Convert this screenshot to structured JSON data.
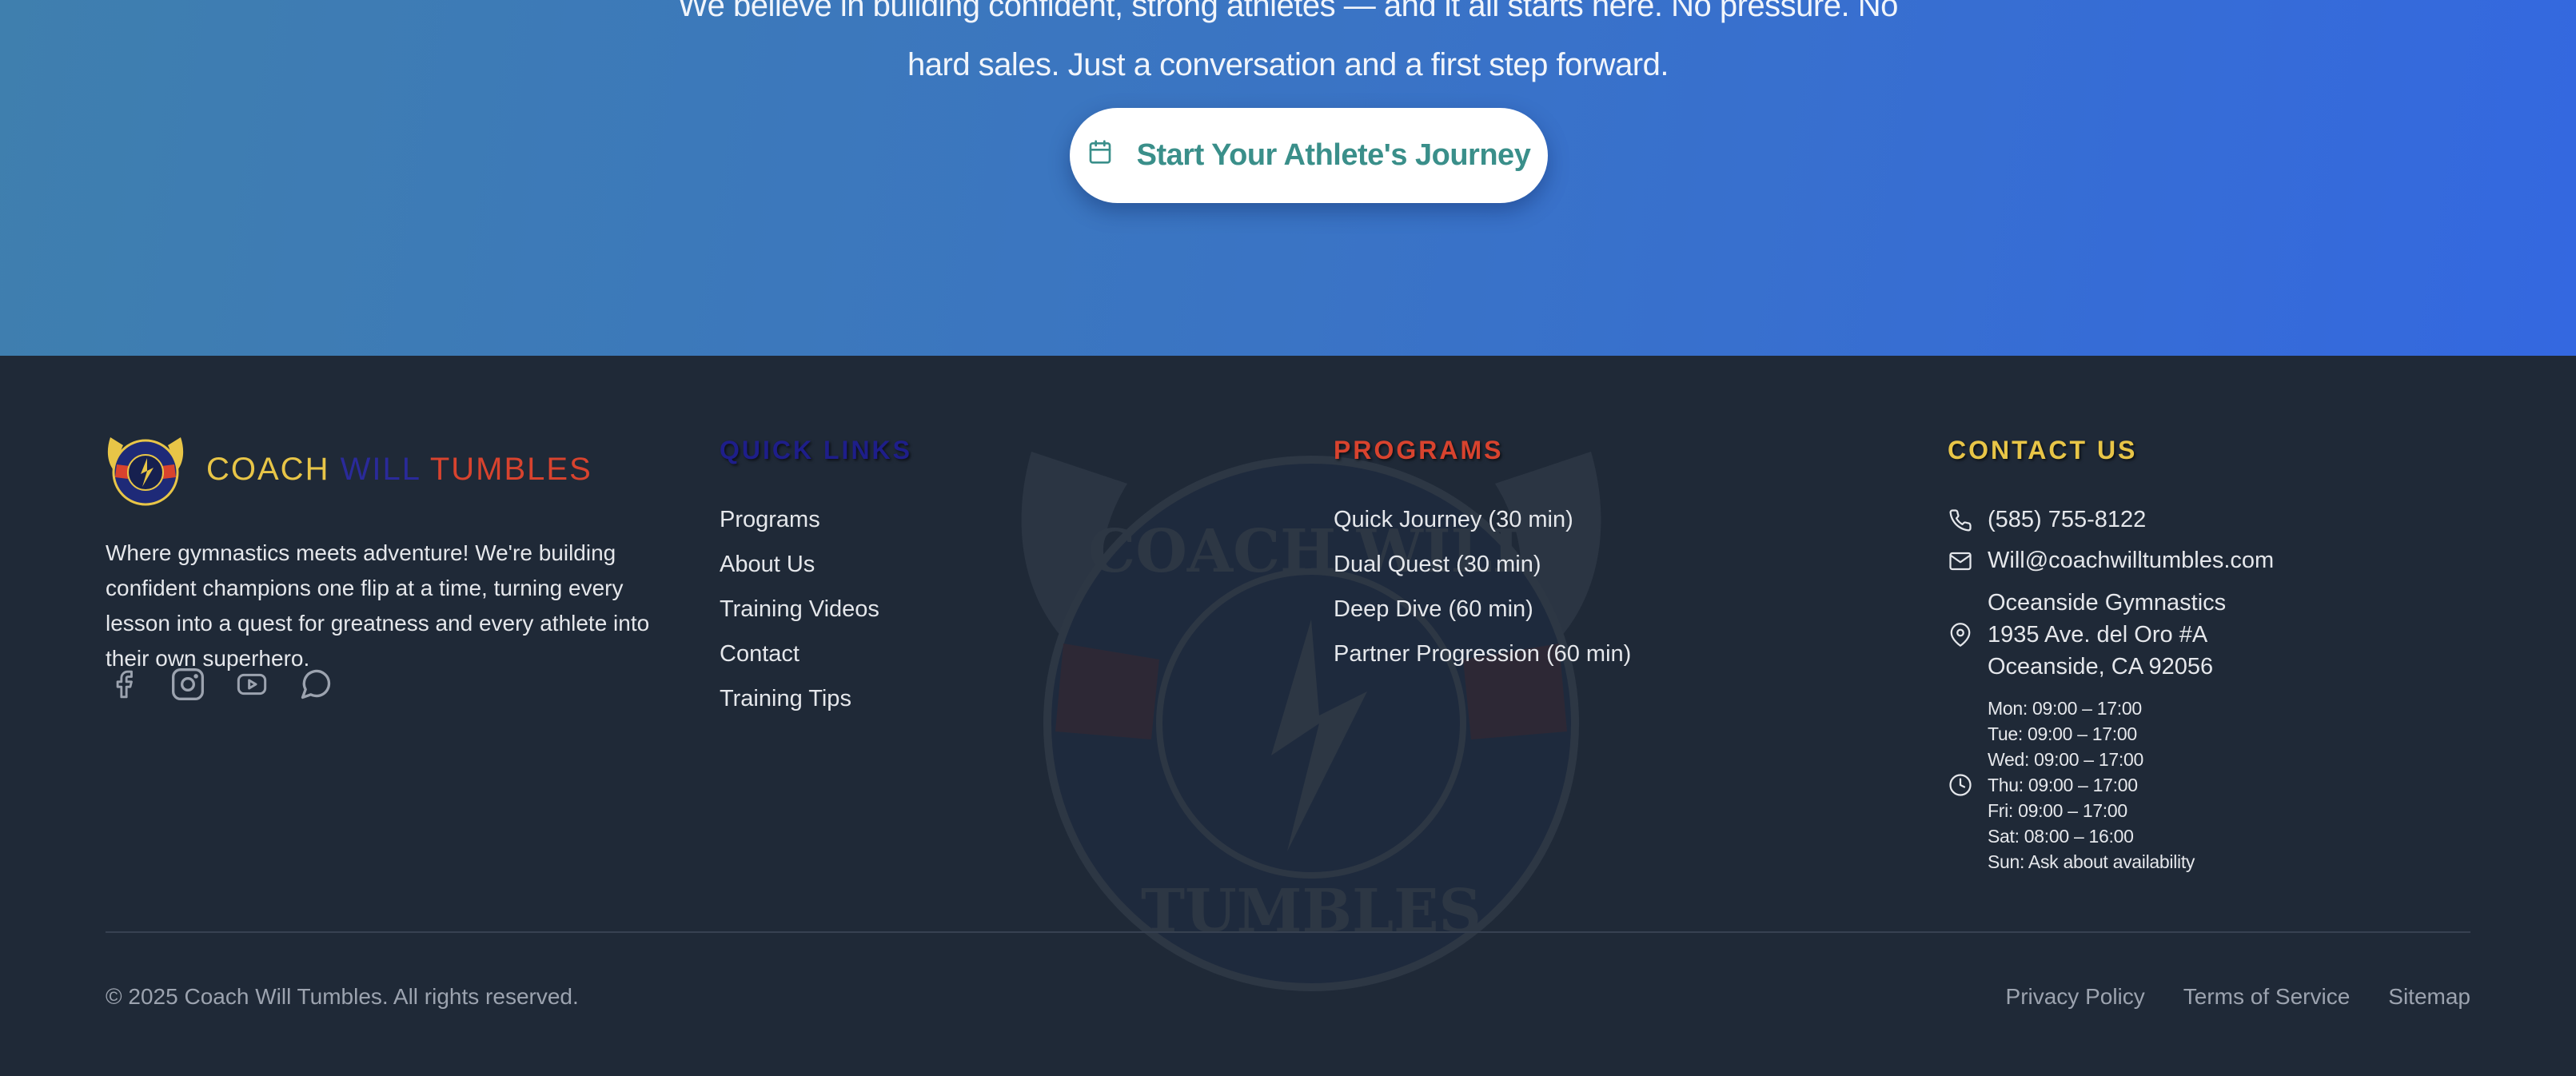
{
  "cta": {
    "line1": "We believe in building confident, strong athletes — and it all starts here. No pressure. No",
    "line2": "hard sales. Just a conversation and a first step forward.",
    "button_label": "Start Your Athlete's Journey",
    "button_icon": "calendar-icon"
  },
  "brand": {
    "name_part1": "COACH",
    "name_part2": "WILL",
    "name_part3": "TUMBLES",
    "logo_text_top": "COACH WILL",
    "logo_text_bottom": "TUMBLES",
    "description": "Where gymnastics meets adventure! We're building confident champions one flip at a time, turning every lesson into a quest for greatness and every athlete into their own superhero.",
    "social_icons": [
      "facebook-icon",
      "instagram-icon",
      "youtube-icon",
      "chat-icon"
    ],
    "colors": {
      "gold": "#e8c547",
      "navy": "#2a2a9a",
      "red": "#d8432e"
    }
  },
  "quick_links": {
    "title": "QUICK LINKS",
    "title_color": "#1e1e8a",
    "items": [
      "Programs",
      "About Us",
      "Training Videos",
      "Contact",
      "Training Tips"
    ]
  },
  "programs": {
    "title": "PROGRAMS",
    "title_color": "#d8432e",
    "items": [
      "Quick Journey (30 min)",
      "Dual Quest (30 min)",
      "Deep Dive (60 min)",
      "Partner Progression (60 min)"
    ]
  },
  "contact": {
    "title": "CONTACT US",
    "title_color": "#e8c547",
    "phone": "(585) 755-8122",
    "email": "Will@coachwilltumbles.com",
    "address_line1": "Oceanside Gymnastics",
    "address_line2": "1935 Ave. del Oro #A",
    "address_line3": "Oceanside, CA 92056",
    "hours": [
      "Mon: 09:00 – 17:00",
      "Tue: 09:00 – 17:00",
      "Wed: 09:00 – 17:00",
      "Thu: 09:00 – 17:00",
      "Fri: 09:00 – 17:00",
      "Sat: 08:00 – 16:00",
      "Sun: Ask about availability"
    ]
  },
  "bottom": {
    "copyright": "© 2025 Coach Will Tumbles. All rights reserved.",
    "legal_links": [
      "Privacy Policy",
      "Terms of Service",
      "Sitemap"
    ]
  },
  "watermark_text_top": "COACH WILL",
  "watermark_text_bottom": "TUMBLES"
}
